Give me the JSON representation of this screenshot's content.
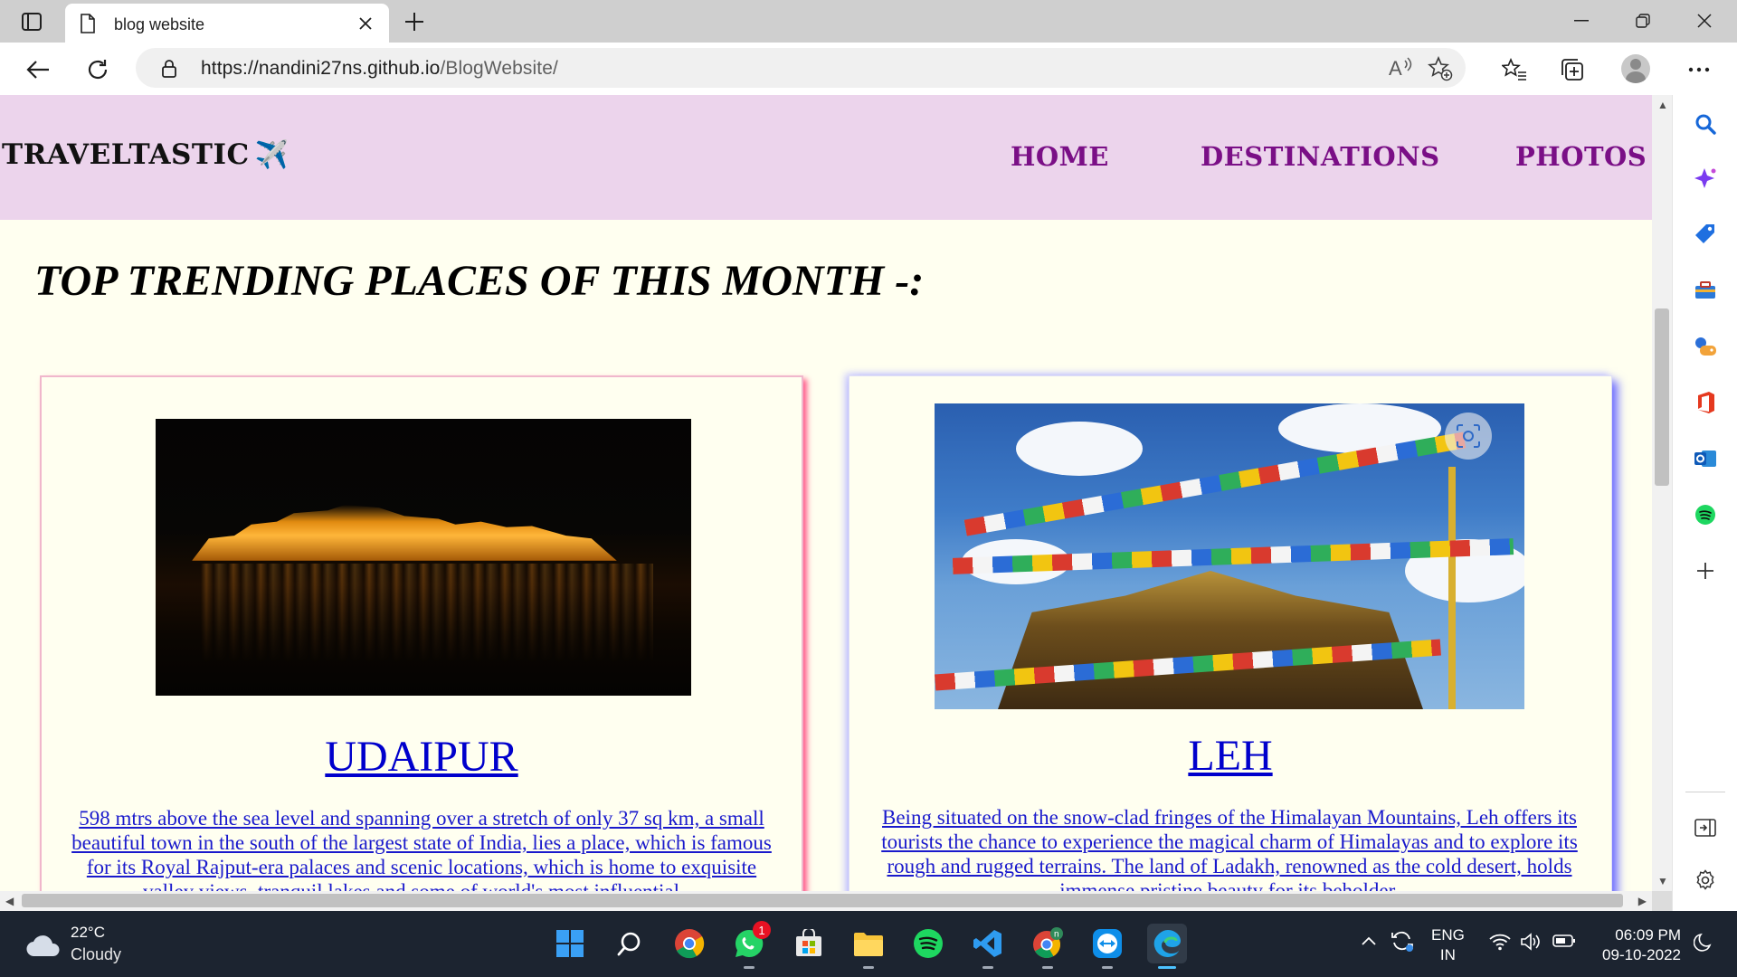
{
  "browser": {
    "tab": {
      "title": "blog website"
    },
    "address": {
      "host": "https://nandini27ns.github.io",
      "path": "/BlogWebsite/"
    }
  },
  "site": {
    "brand": "TRAVELTASTIC",
    "brand_emoji": "✈️",
    "nav": [
      "HOME",
      "DESTINATIONS",
      "PHOTOS"
    ],
    "colors": {
      "nav_bg": "#ecd4ec",
      "nav_link": "#7a0f86",
      "page_bg": "#fffff0",
      "link": "#0000cc"
    },
    "section_title": "TOP TRENDING PLACES OF THIS MONTH -:",
    "cards": [
      {
        "title": "UDAIPUR",
        "text": "598 mtrs above the sea level and spanning over a stretch of only 37 sq km, a small beautiful town in the south of the largest state of India, lies a place, which is famous for its Royal Rajput-era palaces and scenic locations, which is home to exquisite valley views, tranquil lakes and some of world's most influential ..."
      },
      {
        "title": "LEH",
        "text": "Being situated on the snow-clad fringes of the Himalayan Mountains, Leh offers its tourists the chance to experience the magical charm of Himalayas and to explore its rough and rugged terrains. The land of Ladakh, renowned as the cold desert, holds immense pristine beauty for its beholder."
      }
    ]
  },
  "taskbar": {
    "weather": {
      "temp": "22°C",
      "condition": "Cloudy"
    },
    "whatsapp_badge": "1",
    "language": {
      "line1": "ENG",
      "line2": "IN"
    },
    "clock": {
      "time": "06:09 PM",
      "date": "09-10-2022"
    }
  }
}
